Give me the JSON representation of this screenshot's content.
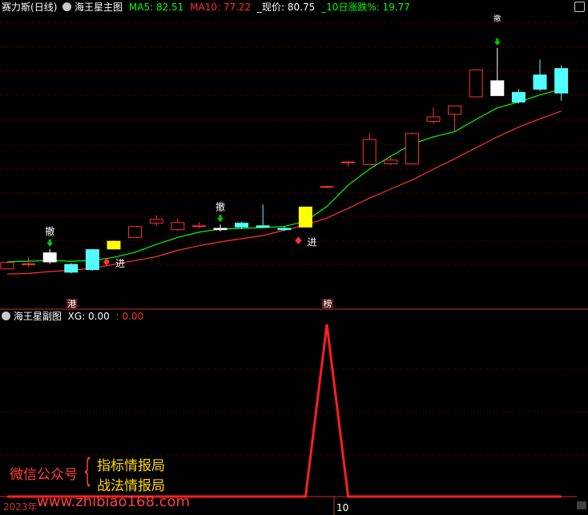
{
  "main_header": {
    "stock_name": "赛力斯",
    "period": "(日线)",
    "indicator_name": "海王星主图",
    "ma5_label": "MA5: 82.51",
    "ma10_label": "MA10: 77.22",
    "price_label": "_现价: 80.75",
    "change_label": "_10日涨跌%: 19.77"
  },
  "sub_header": {
    "indicator_name": "海王星副图",
    "xg_label": "XG: 0.00",
    "xg_value2": ": 0.00"
  },
  "watermark": {
    "left_text": "微信公众号",
    "right_line1": "指标情报局",
    "right_line2": "战法情报局",
    "url": "www.zhibiao168.com"
  },
  "axis": {
    "year_label": "2023年",
    "month_label": "10"
  },
  "colors": {
    "up": "#ff3232",
    "down": "#54ffff",
    "ma5": "#00ff00",
    "ma10": "#ff3232",
    "signal_white": "#ffffff",
    "signal_yellow": "#ffff00",
    "grid": "#8b0000"
  },
  "chart_data": [
    {
      "type": "candlestick",
      "title": "海王星主图",
      "ylim": [
        57,
        101
      ],
      "candles": [
        {
          "o": 61.5,
          "c": 62.5,
          "h": 62.5,
          "l": 61.5,
          "color": "up"
        },
        {
          "o": 62.3,
          "c": 62.3,
          "h": 63.3,
          "l": 61.8,
          "color": "up"
        },
        {
          "o": 64.0,
          "c": 62.6,
          "h": 64.6,
          "l": 62.3,
          "color": "white",
          "mark": "撤",
          "arrow": true
        },
        {
          "o": 62.2,
          "c": 61.0,
          "h": 62.4,
          "l": 60.8,
          "color": "down"
        },
        {
          "o": 64.5,
          "c": 61.4,
          "h": 64.6,
          "l": 61.2,
          "color": "down"
        },
        {
          "o": 64.6,
          "c": 65.8,
          "h": 65.9,
          "l": 64.6,
          "color": "yellow",
          "mark": "进",
          "mark_pos": "below"
        },
        {
          "o": 66.4,
          "c": 68.1,
          "h": 68.1,
          "l": 66.4,
          "color": "up"
        },
        {
          "o": 68.6,
          "c": 69.2,
          "h": 69.8,
          "l": 68.2,
          "color": "up"
        },
        {
          "o": 67.6,
          "c": 68.7,
          "h": 69.3,
          "l": 67.4,
          "color": "up"
        },
        {
          "o": 68.2,
          "c": 68.2,
          "h": 68.8,
          "l": 67.8,
          "color": "up"
        },
        {
          "o": 67.8,
          "c": 67.6,
          "h": 68.4,
          "l": 67.3,
          "color": "white",
          "mark": "撤",
          "arrow": true
        },
        {
          "o": 68.6,
          "c": 68.0,
          "h": 68.8,
          "l": 67.7,
          "color": "down"
        },
        {
          "o": 68.2,
          "c": 68.0,
          "h": 71.5,
          "l": 67.9,
          "color": "down"
        },
        {
          "o": 67.8,
          "c": 67.6,
          "h": 68.1,
          "l": 67.4,
          "color": "down"
        },
        {
          "o": 68.0,
          "c": 71.1,
          "h": 71.1,
          "l": 67.9,
          "color": "yellow",
          "mark": "进",
          "mark_pos": "below"
        },
        {
          "o": 74.3,
          "c": 74.3,
          "h": 74.4,
          "l": 74.0,
          "color": "up"
        },
        {
          "o": 78.1,
          "c": 78.1,
          "h": 78.2,
          "l": 77.4,
          "color": "up"
        },
        {
          "o": 77.7,
          "c": 81.6,
          "h": 82.6,
          "l": 77.6,
          "color": "up"
        },
        {
          "o": 77.8,
          "c": 78.4,
          "h": 78.9,
          "l": 77.6,
          "color": "up"
        },
        {
          "o": 77.8,
          "c": 82.5,
          "h": 82.7,
          "l": 77.7,
          "color": "up"
        },
        {
          "o": 84.4,
          "c": 85.1,
          "h": 86.6,
          "l": 84.0,
          "color": "up"
        },
        {
          "o": 85.5,
          "c": 86.8,
          "h": 86.8,
          "l": 82.8,
          "color": "up"
        },
        {
          "o": 88.2,
          "c": 92.4,
          "h": 92.4,
          "l": 88.2,
          "color": "up"
        },
        {
          "o": 88.4,
          "c": 90.7,
          "h": 95.8,
          "l": 88.4,
          "color": "white",
          "mark": "撤",
          "arrow": true,
          "mark_pos": "top"
        },
        {
          "o": 88.9,
          "c": 87.4,
          "h": 89.4,
          "l": 87.2,
          "color": "down"
        },
        {
          "o": 91.6,
          "c": 89.4,
          "h": 94.0,
          "l": 89.1,
          "color": "down"
        },
        {
          "o": 92.6,
          "c": 88.8,
          "h": 93.1,
          "l": 87.6,
          "color": "down"
        }
      ],
      "ma5": [
        62.6,
        62.7,
        62.8,
        62.7,
        62.8,
        63.3,
        64.1,
        65.3,
        66.4,
        67.2,
        67.7,
        67.8,
        67.9,
        68.1,
        68.9,
        71.2,
        74.5,
        77.0,
        79.0,
        80.9,
        82.0,
        82.8,
        84.7,
        86.5,
        87.4,
        88.5,
        89.4
      ],
      "ma10": [
        60.7,
        60.8,
        61.1,
        61.3,
        61.6,
        62.2,
        62.8,
        63.4,
        64.4,
        65.1,
        65.7,
        66.2,
        66.7,
        67.5,
        68.3,
        69.4,
        70.9,
        72.5,
        73.9,
        75.3,
        77.0,
        78.6,
        80.3,
        82.0,
        83.5,
        84.8,
        86.0
      ],
      "bottom_tags": [
        {
          "index": 3,
          "text": "港"
        },
        {
          "index": 15,
          "text": "榜"
        }
      ]
    },
    {
      "type": "line",
      "title": "海王星副图",
      "series": [
        {
          "name": "XG",
          "values": [
            0,
            0,
            0,
            0,
            0,
            0,
            0,
            0,
            0,
            0,
            0,
            0,
            0,
            0,
            0,
            1,
            0,
            0,
            0,
            0,
            0,
            0,
            0,
            0,
            0,
            0,
            0
          ]
        }
      ],
      "ylim": [
        0,
        1
      ]
    }
  ]
}
